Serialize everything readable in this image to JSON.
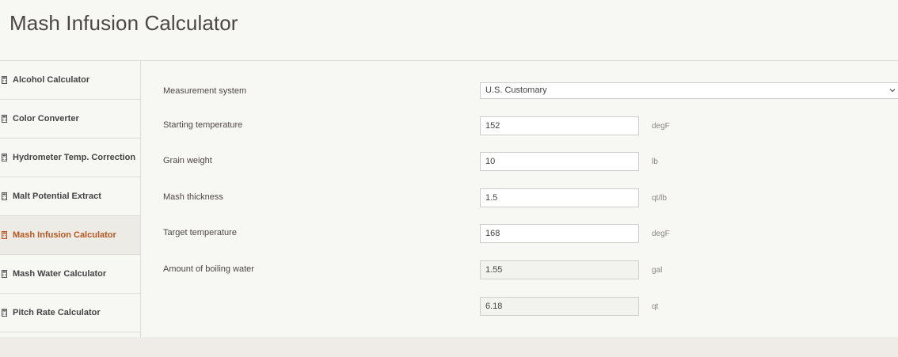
{
  "page": {
    "title": "Mash Infusion Calculator"
  },
  "sidebar": {
    "items": [
      {
        "label": "Alcohol Calculator",
        "icon": "calculator-icon",
        "active": false
      },
      {
        "label": "Color Converter",
        "icon": "calculator-icon",
        "active": false
      },
      {
        "label": "Hydrometer Temp. Correction",
        "icon": "calculator-icon",
        "active": false
      },
      {
        "label": "Malt Potential Extract",
        "icon": "calculator-icon",
        "active": false
      },
      {
        "label": "Mash Infusion Calculator",
        "icon": "calculator-icon",
        "active": true
      },
      {
        "label": "Mash Water Calculator",
        "icon": "calculator-icon",
        "active": false
      },
      {
        "label": "Pitch Rate Calculator",
        "icon": "calculator-icon",
        "active": false
      }
    ]
  },
  "form": {
    "measurement": {
      "label": "Measurement system",
      "value": "U.S. Customary"
    },
    "starting_temp": {
      "label": "Starting temperature",
      "value": "152",
      "unit": "degF"
    },
    "grain_weight": {
      "label": "Grain weight",
      "value": "10",
      "unit": "lb"
    },
    "mash_thickness": {
      "label": "Mash thickness",
      "value": "1.5",
      "unit": "qt/lb"
    },
    "target_temp": {
      "label": "Target temperature",
      "value": "168",
      "unit": "degF"
    },
    "boiling_water": {
      "label": "Amount of boiling water",
      "value": "1.55",
      "unit": "gal"
    },
    "boiling_water_qt": {
      "value": "6.18",
      "unit": "qt"
    }
  },
  "colors": {
    "accent": "#b8561f",
    "text": "#4b4743",
    "muted": "#8b8782"
  }
}
